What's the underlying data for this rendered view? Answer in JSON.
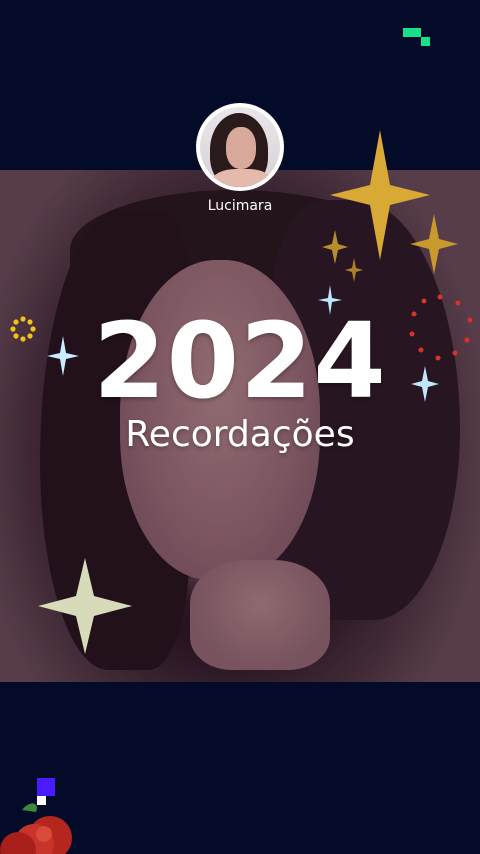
{
  "profile": {
    "name": "Lucimara"
  },
  "title": {
    "year": "2024",
    "subtitle": "Recordações"
  },
  "colors": {
    "background": "#040b28",
    "accent_green": "#18e08a",
    "accent_purple": "#4a1bff",
    "gold": "#e0b53a",
    "white": "#ffffff"
  },
  "icons": [
    "sparkle-icon",
    "star-icon",
    "dots-circle-icon",
    "flower-icon"
  ]
}
